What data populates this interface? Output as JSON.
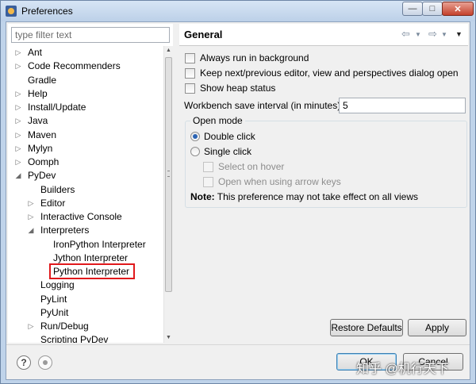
{
  "window": {
    "title": "Preferences"
  },
  "filter": {
    "placeholder": "type filter text"
  },
  "tree": {
    "items": [
      {
        "label": "Ant",
        "arrow": "▷"
      },
      {
        "label": "Code Recommenders",
        "arrow": "▷"
      },
      {
        "label": "Gradle",
        "arrow": ""
      },
      {
        "label": "Help",
        "arrow": "▷"
      },
      {
        "label": "Install/Update",
        "arrow": "▷"
      },
      {
        "label": "Java",
        "arrow": "▷"
      },
      {
        "label": "Maven",
        "arrow": "▷"
      },
      {
        "label": "Mylyn",
        "arrow": "▷"
      },
      {
        "label": "Oomph",
        "arrow": "▷"
      },
      {
        "label": "PyDev",
        "arrow": "◢"
      },
      {
        "label": "Builders",
        "arrow": ""
      },
      {
        "label": "Editor",
        "arrow": "▷"
      },
      {
        "label": "Interactive Console",
        "arrow": "▷"
      },
      {
        "label": "Interpreters",
        "arrow": "◢"
      },
      {
        "label": "IronPython Interpreter",
        "arrow": ""
      },
      {
        "label": "Jython Interpreter",
        "arrow": ""
      },
      {
        "label": "Python Interpreter",
        "arrow": "",
        "highlighted": true
      },
      {
        "label": "Logging",
        "arrow": ""
      },
      {
        "label": "PyLint",
        "arrow": ""
      },
      {
        "label": "PyUnit",
        "arrow": ""
      },
      {
        "label": "Run/Debug",
        "arrow": "▷"
      },
      {
        "label": "Scripting PyDev",
        "arrow": ""
      }
    ]
  },
  "page": {
    "title": "General",
    "options": {
      "always_run_background": "Always run in background",
      "keep_next_prev": "Keep next/previous editor, view and perspectives dialog open",
      "show_heap": "Show heap status"
    },
    "save_interval": {
      "label": "Workbench save interval (in minutes):",
      "value": "5"
    },
    "open_mode": {
      "legend": "Open mode",
      "double_click": "Double click",
      "single_click": "Single click",
      "select_on_hover": "Select on hover",
      "open_arrow_keys": "Open when using arrow keys",
      "note_label": "Note:",
      "note_text": " This preference may not take effect on all views",
      "selected": "double_click"
    },
    "buttons": {
      "restore_defaults": "Restore Defaults",
      "apply": "Apply"
    }
  },
  "footer": {
    "ok": "OK",
    "cancel": "Cancel",
    "watermark": "知乎 @机行天下"
  },
  "icons": {
    "help": "?",
    "nav_back": "⇦",
    "nav_forward": "⇨",
    "dropdown": "▼"
  }
}
